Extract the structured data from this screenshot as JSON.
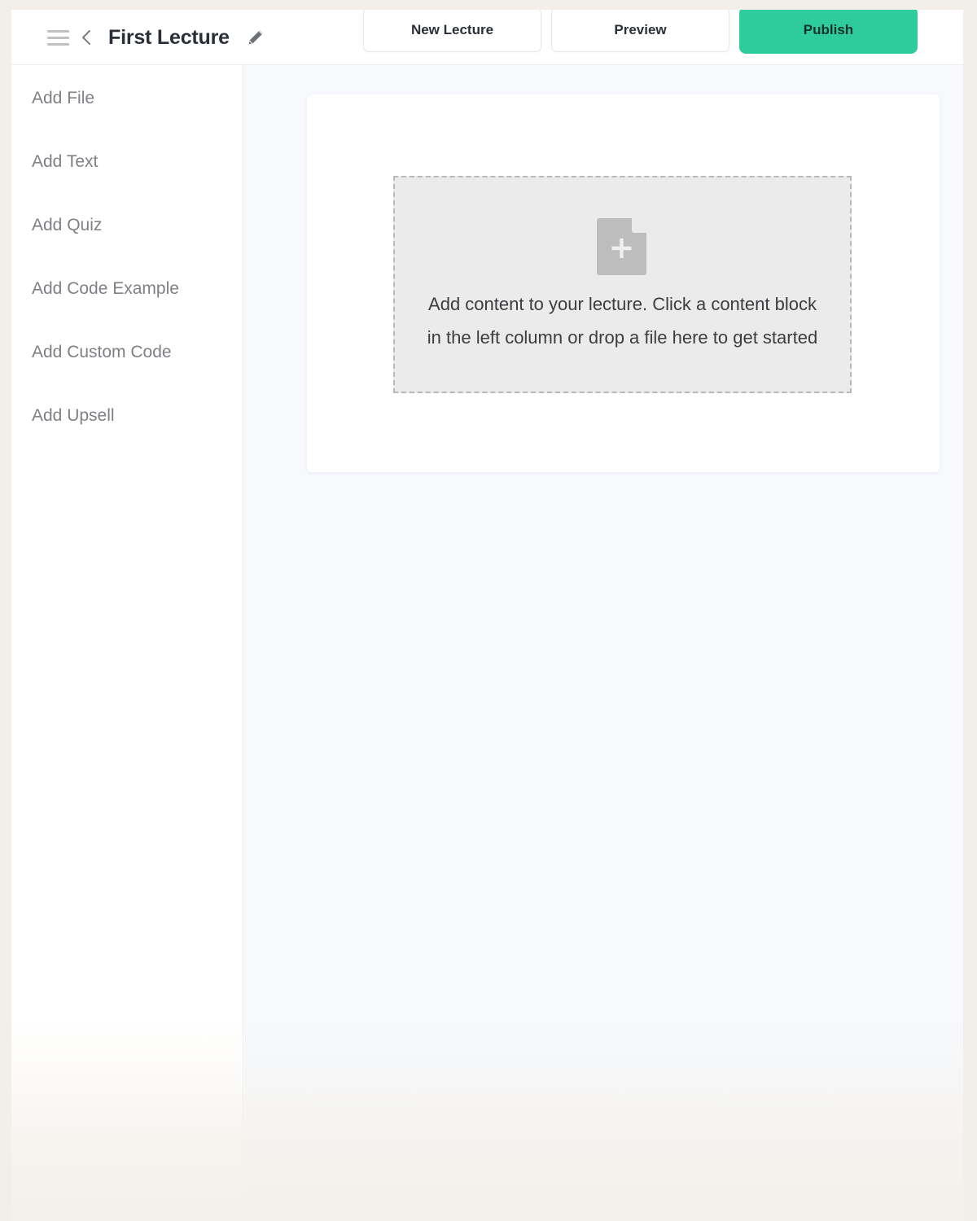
{
  "theme": {
    "page_background": "#f2efe9",
    "app_background": "#ffffff",
    "canvas_background": "#f7f9fd",
    "accent_green": "#2ecc9c",
    "muted_text": "#7e8085",
    "title_text": "#2b2f38",
    "dropzone_fill": "#ebebeb",
    "dropzone_border": "#b9b9b9"
  },
  "header": {
    "menu_icon": "hamburger-icon",
    "back_icon": "chevron-left-icon",
    "title": "First Lecture",
    "edit_icon": "pencil-icon",
    "actions": [
      {
        "label": "New Lecture",
        "style": "secondary",
        "name": "new-lecture-button"
      },
      {
        "label": "Preview",
        "style": "secondary",
        "name": "preview-button"
      },
      {
        "label": "Publish",
        "style": "primary",
        "name": "publish-button"
      }
    ]
  },
  "sidebar": {
    "items": [
      {
        "label": "Add File",
        "name": "sidebar-item-add-file"
      },
      {
        "label": "Add Text",
        "name": "sidebar-item-add-text"
      },
      {
        "label": "Add Quiz",
        "name": "sidebar-item-add-quiz"
      },
      {
        "label": "Add Code Example",
        "name": "sidebar-item-add-code-example"
      },
      {
        "label": "Add Custom Code",
        "name": "sidebar-item-add-custom-code"
      },
      {
        "label": "Add Upsell",
        "name": "sidebar-item-add-upsell"
      }
    ]
  },
  "main": {
    "dropzone": {
      "icon": "file-plus-icon",
      "message": "Add content to your lecture. Click a content block in the left column or drop a file here to get started"
    }
  }
}
